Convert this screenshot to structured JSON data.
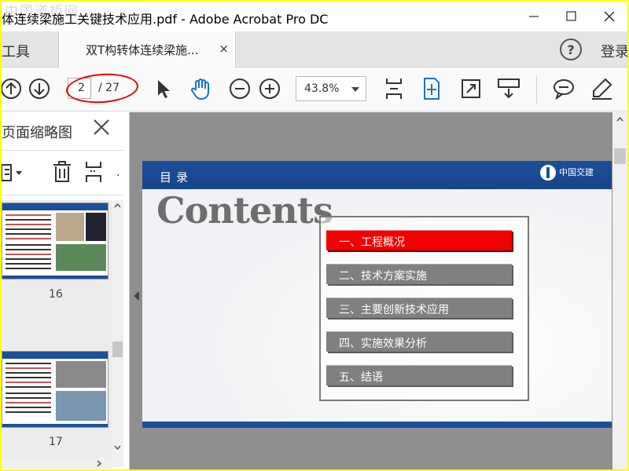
{
  "window": {
    "title": "体连续梁施工关键技术应用.pdf - Adobe Acrobat Pro DC",
    "watermark": "中国道桥网"
  },
  "tabs": {
    "tools_label": "工具",
    "doc_tab_label": "双T构转体连续梁施...",
    "close_glyph": "×",
    "help_glyph": "?",
    "login_label": "登录"
  },
  "toolbar": {
    "page_current": "2",
    "page_total": "/ 27",
    "zoom_value": "43.8%"
  },
  "sidebar": {
    "title": "页面缩略图",
    "thumbnails": [
      {
        "page_label": "16"
      },
      {
        "page_label": "17"
      }
    ]
  },
  "slide": {
    "header_title": "目录",
    "logo_text": "中国交建",
    "heading": "Contents",
    "toc_items": [
      {
        "label": "一、工程概况",
        "active": true
      },
      {
        "label": "二、技术方案实施",
        "active": false
      },
      {
        "label": "三、主要创新技术应用",
        "active": false
      },
      {
        "label": "四、实施效果分析",
        "active": false
      },
      {
        "label": "五、结语",
        "active": false
      }
    ]
  },
  "colors": {
    "frame": "#ffff00",
    "accent_blue": "#1c4f9a",
    "active_red": "#f00000",
    "annotation_oval": "#e00000",
    "tool_blue": "#1a73c8"
  },
  "icons": {
    "titlebar": [
      "minimize-icon",
      "maximize-icon",
      "close-icon"
    ],
    "toolbar": [
      "page-up-icon",
      "page-down-icon",
      "select-arrow-icon",
      "hand-icon",
      "zoom-out-icon",
      "zoom-in-icon",
      "fit-page-icon",
      "fit-width-icon",
      "fullscreen-icon",
      "read-mode-icon",
      "comment-icon",
      "highlight-pen-icon"
    ],
    "sidebar": [
      "options-icon",
      "trash-icon",
      "crop-icon"
    ]
  }
}
